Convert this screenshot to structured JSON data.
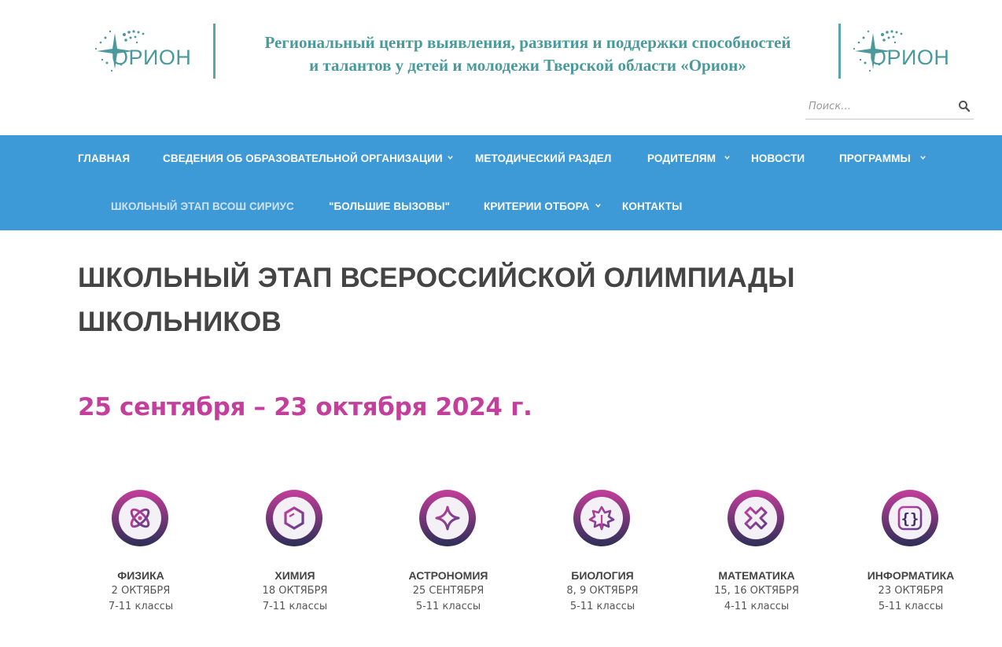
{
  "header": {
    "logo_text": "ОРИОН",
    "title_line1": "Региональный центр выявления, развития и поддержки способностей",
    "title_line2": "и талантов у детей и молодежи Тверской области «Орион»",
    "accent_color": "#4a9a9c"
  },
  "search": {
    "placeholder": "Поиск…",
    "icon": "search-icon"
  },
  "nav": {
    "background": "#3e9ad6",
    "items": [
      {
        "label": "Главная",
        "has_submenu": false
      },
      {
        "label": "Сведения об образовательной организации",
        "has_submenu": true
      },
      {
        "label": "Методический раздел",
        "has_submenu": false
      },
      {
        "label": "Родителям",
        "has_submenu": true
      },
      {
        "label": "Новости",
        "has_submenu": false
      },
      {
        "label": "Программы",
        "has_submenu": true
      },
      {
        "label": "Школьный этап ВсОШ Сириус",
        "has_submenu": false,
        "active": true
      },
      {
        "label": "\"Большие вызовы\"",
        "has_submenu": false
      },
      {
        "label": "Критерии отбора",
        "has_submenu": true
      },
      {
        "label": "Контакты",
        "has_submenu": false
      }
    ]
  },
  "main": {
    "title_line1": "ШКОЛЬНЫЙ ЭТАП ВСЕРОССИЙСКОЙ ОЛИМПИАДЫ",
    "title_line2": "ШКОЛЬНИКОВ",
    "dates": "25 сентября – 23 октября 2024 г.",
    "dates_color": "#c43e9b",
    "subjects": [
      {
        "name": "ФИЗИКА",
        "date": "2 ОКТЯБРЯ",
        "grades": "7-11 классы",
        "icon": "atom-icon"
      },
      {
        "name": "ХИМИЯ",
        "date": "18 ОКТЯБРЯ",
        "grades": "7-11 классы",
        "icon": "hexagon-icon"
      },
      {
        "name": "АСТРОНОМИЯ",
        "date": "25 СЕНТЯБРЯ",
        "grades": "5-11 классы",
        "icon": "star-icon"
      },
      {
        "name": "БИОЛОГИЯ",
        "date": "8, 9 ОКТЯБРЯ",
        "grades": "5-11 классы",
        "icon": "leaf-icon"
      },
      {
        "name": "МАТЕМАТИКА",
        "date": "15, 16 ОКТЯБРЯ",
        "grades": "4-11 классы",
        "icon": "multiply-icon"
      },
      {
        "name": "ИНФОРМАТИКА",
        "date": "23 ОКТЯБРЯ",
        "grades": "5-11 классы",
        "icon": "braces-icon"
      }
    ]
  }
}
